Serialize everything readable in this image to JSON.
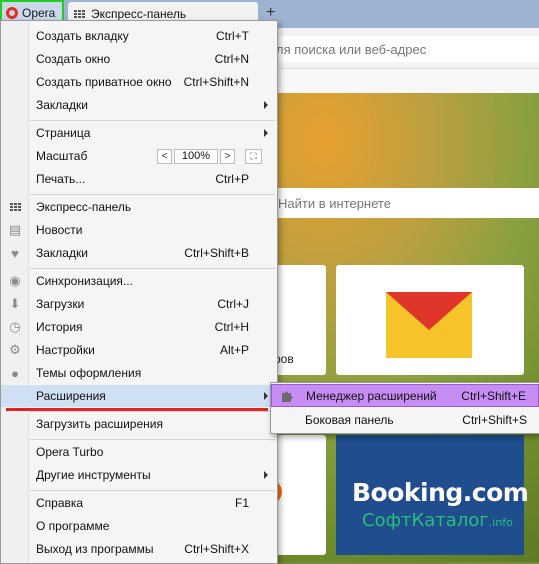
{
  "browser": {
    "menu_button_label": "Opera",
    "tab_title": "Экспресс-панель",
    "new_tab_symbol": "+",
    "address_placeholder": "ля поиска или веб-адрес",
    "page_search_placeholder": "Найти в интернете",
    "tile_label_partial": "ров",
    "booking_logo": "Booking.com",
    "watermark_main": "СофтКаталог",
    "watermark_suffix": ".info"
  },
  "colors": {
    "opera_red": "#e03020",
    "highlight_border": "#22cc22",
    "submenu_highlight": "#c68ef5",
    "menu_highlight": "#cfe0f3",
    "underline_red": "#e02424",
    "booking_blue": "#1f4d8e"
  },
  "main_menu": {
    "items": [
      {
        "label": "Создать вкладку",
        "shortcut": "Ctrl+T"
      },
      {
        "label": "Создать окно",
        "shortcut": "Ctrl+N"
      },
      {
        "label": "Создать приватное окно",
        "shortcut": "Ctrl+Shift+N"
      },
      {
        "label": "Закладки",
        "shortcut": "",
        "submenu": true
      },
      {
        "label": "Страница",
        "shortcut": "",
        "submenu": true
      },
      {
        "label": "Масштаб",
        "shortcut": ""
      },
      {
        "label": "Печать...",
        "shortcut": "Ctrl+P"
      },
      {
        "label": "Экспресс-панель",
        "shortcut": "",
        "icon": "grid-icon"
      },
      {
        "label": "Новости",
        "shortcut": "",
        "icon": "news-icon"
      },
      {
        "label": "Закладки",
        "shortcut": "Ctrl+Shift+B",
        "icon": "heart-icon"
      },
      {
        "label": "Синхронизация...",
        "shortcut": "",
        "icon": "user-sync-icon"
      },
      {
        "label": "Загрузки",
        "shortcut": "Ctrl+J",
        "icon": "download-icon"
      },
      {
        "label": "История",
        "shortcut": "Ctrl+H",
        "icon": "clock-icon"
      },
      {
        "label": "Настройки",
        "shortcut": "Alt+P",
        "icon": "gear-icon"
      },
      {
        "label": "Темы оформления",
        "shortcut": "",
        "icon": "drop-icon"
      },
      {
        "label": "Расширения",
        "shortcut": "",
        "submenu": true,
        "highlighted": true
      },
      {
        "label": "Загрузить расширения",
        "shortcut": ""
      },
      {
        "label": "Opera Turbo",
        "shortcut": ""
      },
      {
        "label": "Другие инструменты",
        "shortcut": "",
        "submenu": true
      },
      {
        "label": "Справка",
        "shortcut": "F1"
      },
      {
        "label": "О программе",
        "shortcut": ""
      },
      {
        "label": "Выход из программы",
        "shortcut": "Ctrl+Shift+X"
      }
    ],
    "zoom": {
      "value": "100%",
      "decrease": "<",
      "increase": ">",
      "fullscreen": "⛶"
    }
  },
  "extensions_submenu": {
    "items": [
      {
        "label": "Менеджер расширений",
        "shortcut": "Ctrl+Shift+E",
        "highlighted": true,
        "icon": "puzzle-icon"
      },
      {
        "label": "Боковая панель",
        "shortcut": "Ctrl+Shift+S"
      }
    ]
  }
}
